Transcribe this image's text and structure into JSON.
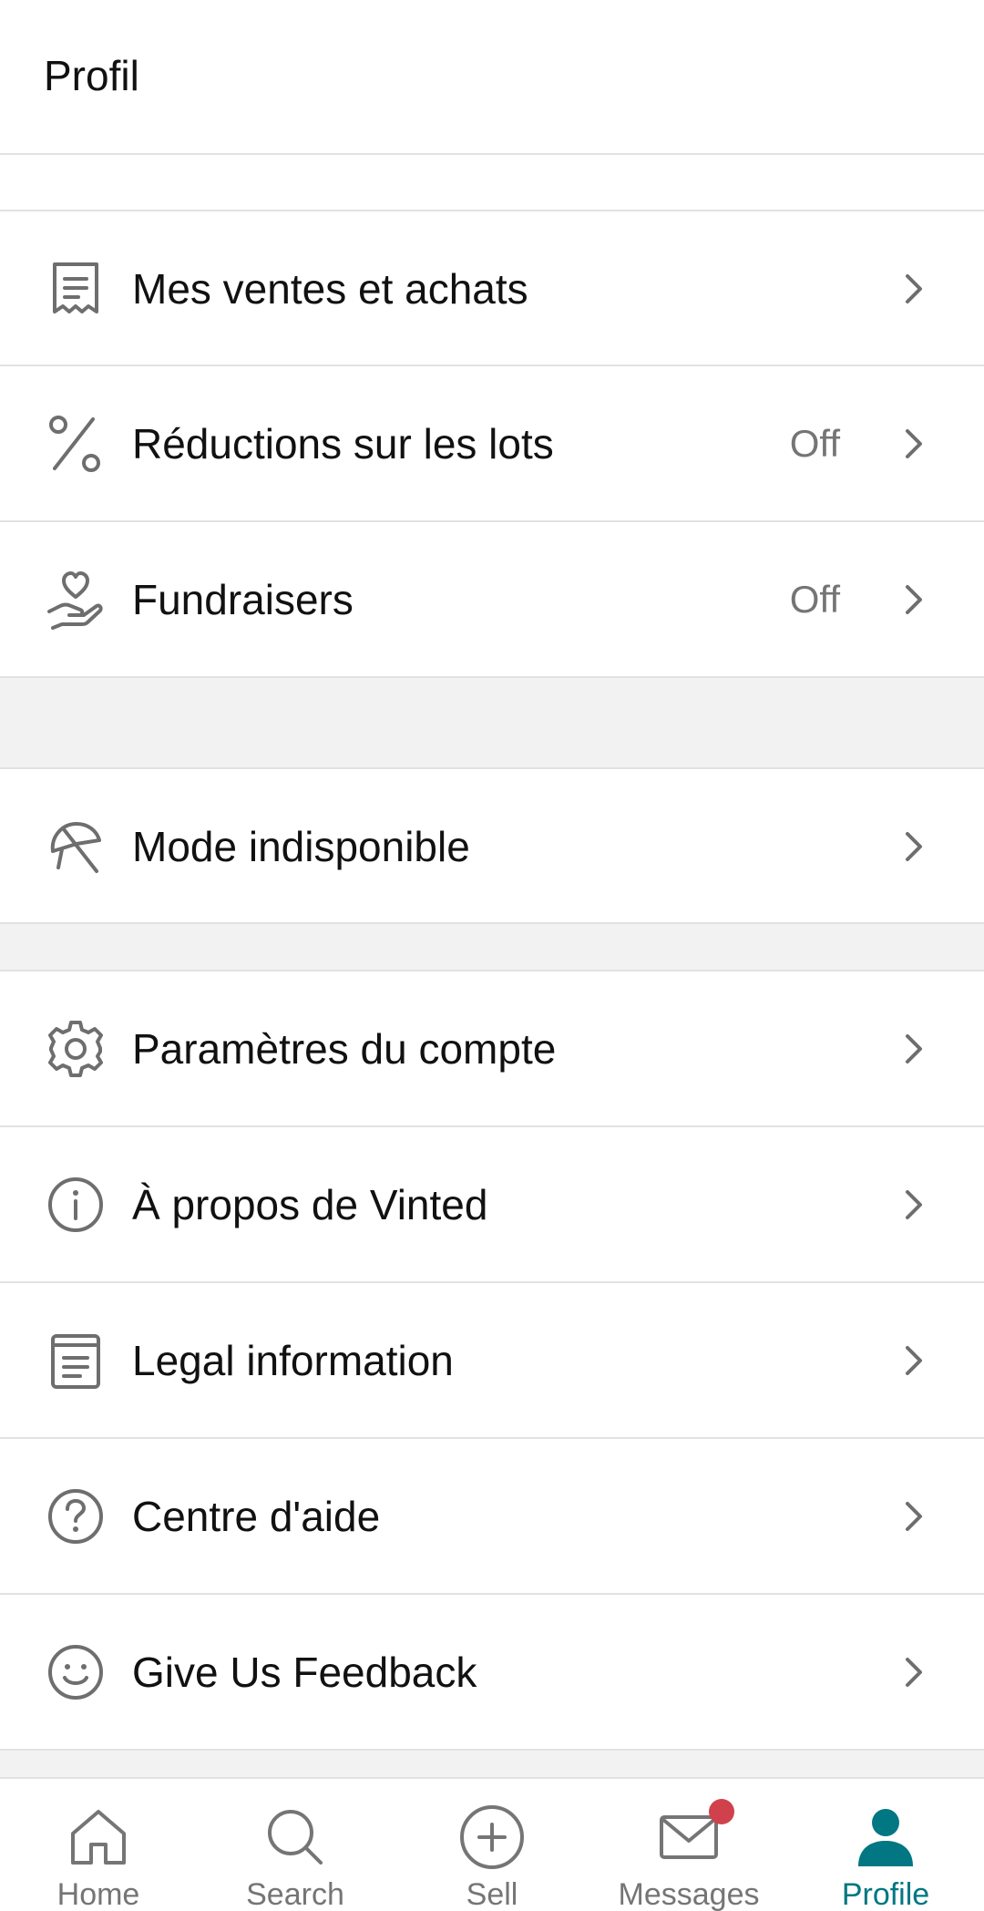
{
  "header": {
    "title": "Profil"
  },
  "menu_items": [
    {
      "label": "Mes ventes et achats",
      "value": "",
      "icon": "receipt-icon"
    },
    {
      "label": "Réductions sur les lots",
      "value": "Off",
      "icon": "percent-icon"
    },
    {
      "label": "Fundraisers",
      "value": "Off",
      "icon": "heart-hand-icon"
    },
    {
      "label": "Mode indisponible",
      "value": "",
      "icon": "umbrella-off-icon"
    },
    {
      "label": "Paramètres du compte",
      "value": "",
      "icon": "gear-icon"
    },
    {
      "label": "À propos de Vinted",
      "value": "",
      "icon": "info-icon"
    },
    {
      "label": "Legal information",
      "value": "",
      "icon": "document-icon"
    },
    {
      "label": "Centre d'aide",
      "value": "",
      "icon": "help-icon"
    },
    {
      "label": "Give Us Feedback",
      "value": "",
      "icon": "smiley-icon"
    }
  ],
  "tabbar": {
    "tabs": [
      {
        "label": "Home",
        "icon": "home-icon",
        "active": false
      },
      {
        "label": "Search",
        "icon": "search-icon",
        "active": false
      },
      {
        "label": "Sell",
        "icon": "plus-circle-icon",
        "active": false
      },
      {
        "label": "Messages",
        "icon": "mail-icon",
        "active": false,
        "has_notification": true
      },
      {
        "label": "Profile",
        "icon": "person-icon",
        "active": true
      }
    ]
  },
  "colors": {
    "accent": "#007782",
    "notification": "#d0414c",
    "text": "#111111",
    "secondary_text": "#757575",
    "section_gap": "#f2f2f2",
    "icon": "#6e6e6e"
  }
}
